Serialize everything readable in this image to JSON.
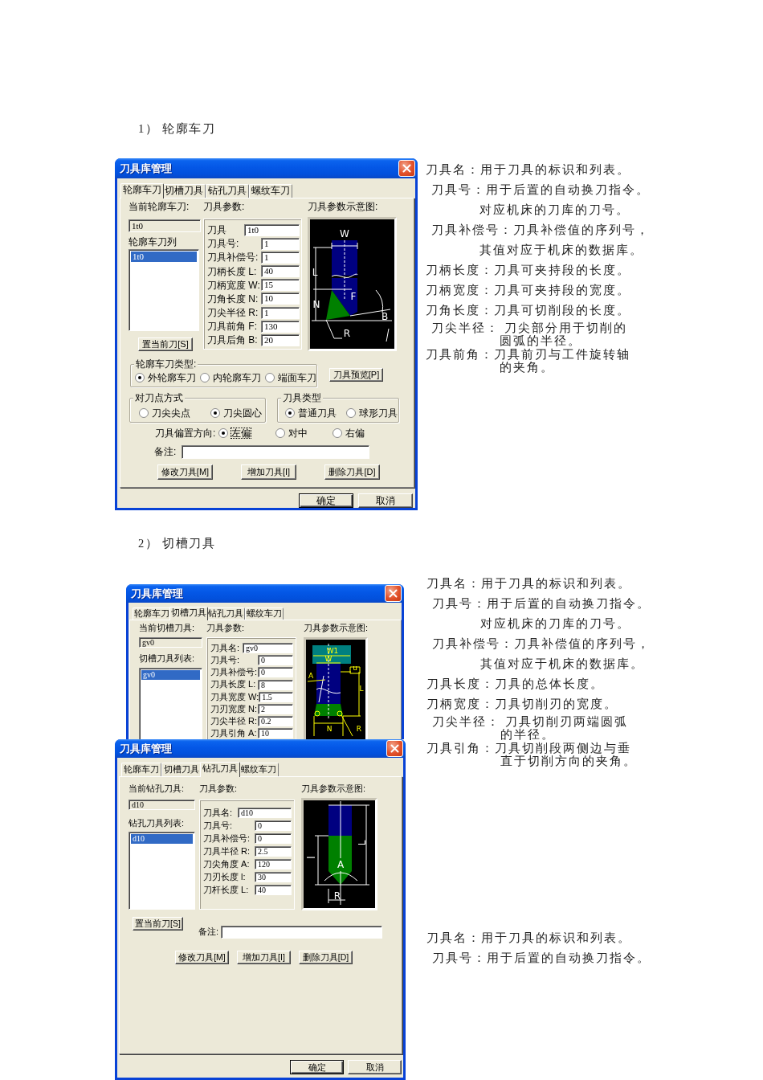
{
  "sections": [
    {
      "heading": "1） 轮廓车刀",
      "dialogs": [
        {
          "kind": "turning",
          "title": "刀具库管理",
          "tabs": [
            {
              "label": "轮廓车刀",
              "selected": true
            },
            {
              "label": "切槽刀具",
              "selected": false
            },
            {
              "label": "钻孔刀具",
              "selected": false
            },
            {
              "label": "螺纹车刀",
              "selected": false
            }
          ],
          "current_label": "当前轮廓车刀:",
          "current_value": "1t0",
          "list_label": "轮廓车刀列",
          "list_items": [
            {
              "text": "1t0",
              "selected": true
            }
          ],
          "set_button": "置当前刀[S]",
          "params_label": "刀具参数:",
          "params": [
            {
              "label": "刀具",
              "value": "1t0"
            },
            {
              "label": "刀具号:",
              "value": "1"
            },
            {
              "label": "刀具补偿号:",
              "value": "1"
            },
            {
              "label": "刀柄长度 L:",
              "value": "40"
            },
            {
              "label": "刀柄宽度 W:",
              "value": "15"
            },
            {
              "label": "刀角长度 N:",
              "value": "10"
            },
            {
              "label": "刀尖半径 R:",
              "value": "1"
            },
            {
              "label": "刀具前角 F:",
              "value": "130"
            },
            {
              "label": "刀具后角 B:",
              "value": "20"
            }
          ],
          "diagram_label": "刀具参数示意图:",
          "diagram_labels": [
            "W",
            "L",
            "N",
            "F",
            "B",
            "R"
          ],
          "option_groups": [
            {
              "label": "轮廓车刀类型:",
              "options": [
                {
                  "label": "外轮廓车刀",
                  "selected": true
                },
                {
                  "label": "内轮廓车刀",
                  "selected": false
                },
                {
                  "label": "端面车刀",
                  "selected": false
                }
              ]
            },
            {
              "label": "对刀点方式",
              "options": [
                {
                  "label": "刀尖尖点",
                  "selected": false
                },
                {
                  "label": "刀尖圆心",
                  "selected": true
                }
              ]
            },
            {
              "label": "刀具类型",
              "options": [
                {
                  "label": "普通刀具",
                  "selected": true
                },
                {
                  "label": "球形刀具",
                  "selected": false
                }
              ]
            }
          ],
          "preview_button": "刀具预览[P]",
          "offset": {
            "label": "刀具偏置方向:",
            "options": [
              {
                "label": "左偏",
                "selected": true,
                "focused": true
              },
              {
                "label": "对中",
                "selected": false,
                "focused": false
              },
              {
                "label": "右偏",
                "selected": false,
                "focused": false
              }
            ]
          },
          "remark_label": "备注:",
          "action_buttons": [
            "修改刀具[M]",
            "增加刀具[I]",
            "删除刀具[D]"
          ],
          "footer_buttons": [
            {
              "label": "确定",
              "default": true
            },
            {
              "label": "取消",
              "default": false
            }
          ]
        }
      ],
      "notes": [
        {
          "lines": [
            "刀具名：用于刀具的标识和列表。"
          ]
        },
        {
          "lines": [
            "刀具号：用于后置的自动换刀指令。"
          ]
        },
        {
          "lines": [
            "对应机床的刀库的刀号。"
          ]
        },
        {
          "lines": [
            "刀具补偿号：刀具补偿值的序列号，"
          ]
        },
        {
          "lines": [
            "其值对应于机床的数据库。"
          ]
        },
        {
          "lines": [
            "刀柄长度：刀具可夹持段的长度。"
          ]
        },
        {
          "lines": [
            "刀柄宽度：刀具可夹持段的宽度。"
          ]
        },
        {
          "lines": [
            "刀角长度：刀具可切削段的长度。"
          ]
        },
        {
          "lines": [
            "刀尖半径： 刀尖部分用于切削的",
            "圆弧的半径。"
          ]
        },
        {
          "lines": [
            "刀具前角：刀具前刃与工件旋转轴",
            "的夹角。"
          ]
        }
      ]
    },
    {
      "heading": "2） 切槽刀具",
      "dialogs": [
        {
          "kind": "grooving",
          "title": "刀具库管理",
          "tabs": [
            {
              "label": "轮廓车刀",
              "selected": false
            },
            {
              "label": "切槽刀具",
              "selected": true
            },
            {
              "label": "钻孔刀具",
              "selected": false
            },
            {
              "label": "螺纹车刀",
              "selected": false
            }
          ],
          "current_label": "当前切槽刀具:",
          "current_value": "gv0",
          "list_label": "切槽刀具列表:",
          "list_items": [
            {
              "text": "gv0",
              "selected": true
            }
          ],
          "params_label": "刀具参数:",
          "params": [
            {
              "label": "刀具名:",
              "value": "gv0"
            },
            {
              "label": "刀具号:",
              "value": "0"
            },
            {
              "label": "刀具补偿号:",
              "value": "0"
            },
            {
              "label": "刀具长度 L:",
              "value": "8"
            },
            {
              "label": "刀具宽度 W:",
              "value": "1.5"
            },
            {
              "label": "刀刃宽度 N:",
              "value": "2"
            },
            {
              "label": "刀尖半径 R:",
              "value": "0.2"
            },
            {
              "label": "刀具引角 A:",
              "value": "10"
            }
          ],
          "diagram_label": "刀具参数示意图:",
          "diagram_labels": [
            "W1",
            "W",
            "u",
            "A",
            "L",
            "N",
            "R"
          ]
        },
        {
          "kind": "drilling",
          "title": "刀具库管理",
          "tabs": [
            {
              "label": "轮廓车刀",
              "selected": false
            },
            {
              "label": "切槽刀具",
              "selected": false
            },
            {
              "label": "钻孔刀具",
              "selected": true
            },
            {
              "label": "螺纹车刀",
              "selected": false
            }
          ],
          "current_label": "当前钻孔刀具:",
          "current_value": "d10",
          "list_label": "钻孔刀具列表:",
          "list_items": [
            {
              "text": "d10",
              "selected": true
            }
          ],
          "set_button": "置当前刀[S]",
          "params_label": "刀具参数:",
          "params": [
            {
              "label": "刀具名:",
              "value": "d10"
            },
            {
              "label": "刀具号:",
              "value": "0"
            },
            {
              "label": "刀具补偿号:",
              "value": "0"
            },
            {
              "label": "刀具半径 R:",
              "value": "2.5"
            },
            {
              "label": "刀尖角度 A:",
              "value": "120"
            },
            {
              "label": "刀刃长度 l:",
              "value": "30"
            },
            {
              "label": "刀杆长度 L:",
              "value": "40"
            }
          ],
          "diagram_label": "刀具参数示意图:",
          "diagram_labels": [
            "L",
            "l",
            "A",
            "R"
          ],
          "remark_label": "备注:",
          "action_buttons": [
            "修改刀具[M]",
            "增加刀具[I]",
            "删除刀具[D]"
          ],
          "footer_buttons": [
            {
              "label": "确定",
              "default": true
            },
            {
              "label": "取消",
              "default": false
            }
          ]
        }
      ],
      "notes": [
        {
          "lines": [
            "刀具名：用于刀具的标识和列表。"
          ]
        },
        {
          "lines": [
            "刀具号：用于后置的自动换刀指令。"
          ]
        },
        {
          "lines": [
            "对应机床的刀库的刀号。"
          ]
        },
        {
          "lines": [
            "刀具补偿号：刀具补偿值的序列号，"
          ]
        },
        {
          "lines": [
            "其值对应于机床的数据库。"
          ]
        },
        {
          "lines": [
            "刀具长度：刀具的总体长度。"
          ]
        },
        {
          "lines": [
            "刀柄宽度：刀具切削刃的宽度。"
          ]
        },
        {
          "lines": [
            "刀尖半径： 刀具切削刃两端圆弧",
            "的半径。"
          ]
        },
        {
          "lines": [
            "刀具引角：刀具切削段两侧边与垂",
            "直于切削方向的夹角。"
          ]
        }
      ],
      "notes_bottom": [
        {
          "lines": [
            "刀具名：用于刀具的标识和列表。"
          ]
        },
        {
          "lines": [
            "刀具号：用于后置的自动换刀指令。"
          ]
        }
      ]
    }
  ]
}
